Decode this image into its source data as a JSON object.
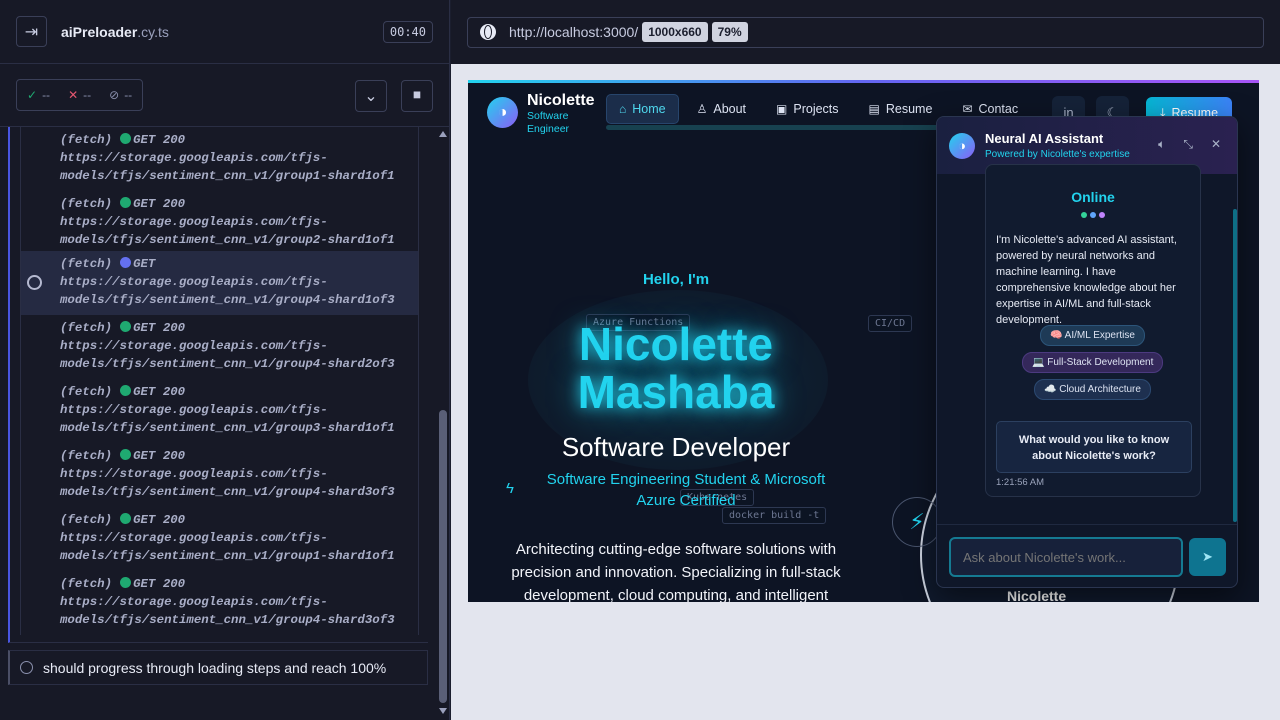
{
  "runner": {
    "spec_name": "aiPreloader",
    "spec_ext": ".cy.ts",
    "timer": "00:40",
    "passed": "--",
    "failed": "--",
    "pending": "--"
  },
  "log": [
    {
      "kind": "(fetch)",
      "method": "GET",
      "status": "200",
      "url1": "https://storage.googleapis.com/tfjs-",
      "url2": "models/tfjs/sentiment_cnn_v1/group1-shard1of1",
      "state": "done"
    },
    {
      "kind": "(fetch)",
      "method": "GET",
      "status": "200",
      "url1": "https://storage.googleapis.com/tfjs-",
      "url2": "models/tfjs/sentiment_cnn_v1/group2-shard1of1",
      "state": "done"
    },
    {
      "kind": "(fetch)",
      "method": "GET",
      "status": "",
      "url1": "https://storage.googleapis.com/tfjs-",
      "url2": "models/tfjs/sentiment_cnn_v1/group4-shard1of3",
      "state": "pending"
    },
    {
      "kind": "(fetch)",
      "method": "GET",
      "status": "200",
      "url1": "https://storage.googleapis.com/tfjs-",
      "url2": "models/tfjs/sentiment_cnn_v1/group4-shard2of3",
      "state": "done"
    },
    {
      "kind": "(fetch)",
      "method": "GET",
      "status": "200",
      "url1": "https://storage.googleapis.com/tfjs-",
      "url2": "models/tfjs/sentiment_cnn_v1/group3-shard1of1",
      "state": "done"
    },
    {
      "kind": "(fetch)",
      "method": "GET",
      "status": "200",
      "url1": "https://storage.googleapis.com/tfjs-",
      "url2": "models/tfjs/sentiment_cnn_v1/group4-shard3of3",
      "state": "done"
    },
    {
      "kind": "(fetch)",
      "method": "GET",
      "status": "200",
      "url1": "https://storage.googleapis.com/tfjs-",
      "url2": "models/tfjs/sentiment_cnn_v1/group1-shard1of1",
      "state": "done"
    },
    {
      "kind": "(fetch)",
      "method": "GET",
      "status": "200",
      "url1": "https://storage.googleapis.com/tfjs-",
      "url2": "models/tfjs/sentiment_cnn_v1/group4-shard3of3",
      "state": "done"
    }
  ],
  "test_title": "should progress through loading steps and reach 100%",
  "browser": {
    "url": "http://localhost:3000/",
    "viewport": "1000x660",
    "zoom": "79%"
  },
  "site": {
    "brand_name": "Nicolette",
    "brand_sub1": "Software",
    "brand_sub2": "Engineer",
    "nav": [
      "Home",
      "About",
      "Projects",
      "Resume",
      "Contac"
    ],
    "resume_button": "Resume",
    "hello": "Hello, I'm",
    "name1": "Nicolette",
    "name2": "Mashaba",
    "role": "Software Developer",
    "tagline": "Software Engineering Student & Microsoft Azure Certified",
    "description": "Architecting cutting-edge software solutions with precision and innovation. Specializing in full-stack development, cloud computing, and intelligent",
    "chips": [
      "Azure Functions",
      "CI/CD",
      "Kubernetes",
      "docker build -t"
    ],
    "deco_name": "Nicolette"
  },
  "chat": {
    "title": "Neural AI Assistant",
    "subtitle": "Powered by Nicolette's expertise",
    "status": "Online",
    "intro": "I'm Nicolette's advanced AI assistant, powered by neural networks and machine learning. I have comprehensive knowledge about her expertise in AI/ML and full-stack development.",
    "tags": [
      "🧠 AI/ML Expertise",
      "💻 Full-Stack Development",
      "☁️ Cloud Architecture"
    ],
    "question": "What would you like to know about Nicolette's work?",
    "time": "1:21:56 AM",
    "input_placeholder": "Ask about Nicolette's work...",
    "colors": {
      "dot1": "#34d399",
      "dot2": "#60a5fa",
      "dot3": "#c084fc"
    }
  }
}
